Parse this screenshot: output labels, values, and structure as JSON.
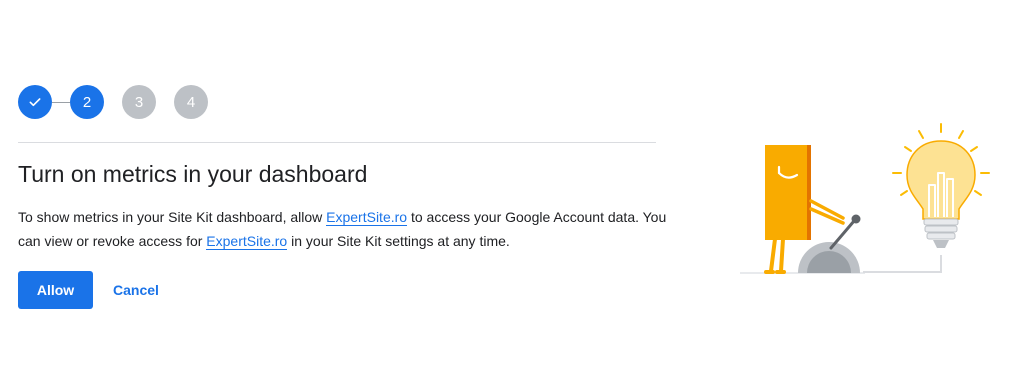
{
  "stepper": {
    "steps": [
      {
        "label": "",
        "state": "complete",
        "icon": "check-icon"
      },
      {
        "label": "2",
        "state": "active"
      },
      {
        "label": "3",
        "state": "pending"
      },
      {
        "label": "4",
        "state": "pending"
      }
    ]
  },
  "content": {
    "title": "Turn on metrics in your dashboard",
    "desc_part1": "To show metrics in your Site Kit dashboard, allow ",
    "site_link_1": "ExpertSite.ro",
    "desc_part2": " to access your Google Account data. You can view or revoke access for ",
    "site_link_2": "ExpertSite.ro",
    "desc_part3": " in your Site Kit settings at any time."
  },
  "actions": {
    "allow_label": "Allow",
    "cancel_label": "Cancel"
  },
  "colors": {
    "accent": "#1a73e8",
    "pending_step": "#bdc1c6",
    "figure": "#f9ab00",
    "bulb": "#fde293"
  },
  "illustration": {
    "icon": "switch-lightbulb-illustration"
  }
}
